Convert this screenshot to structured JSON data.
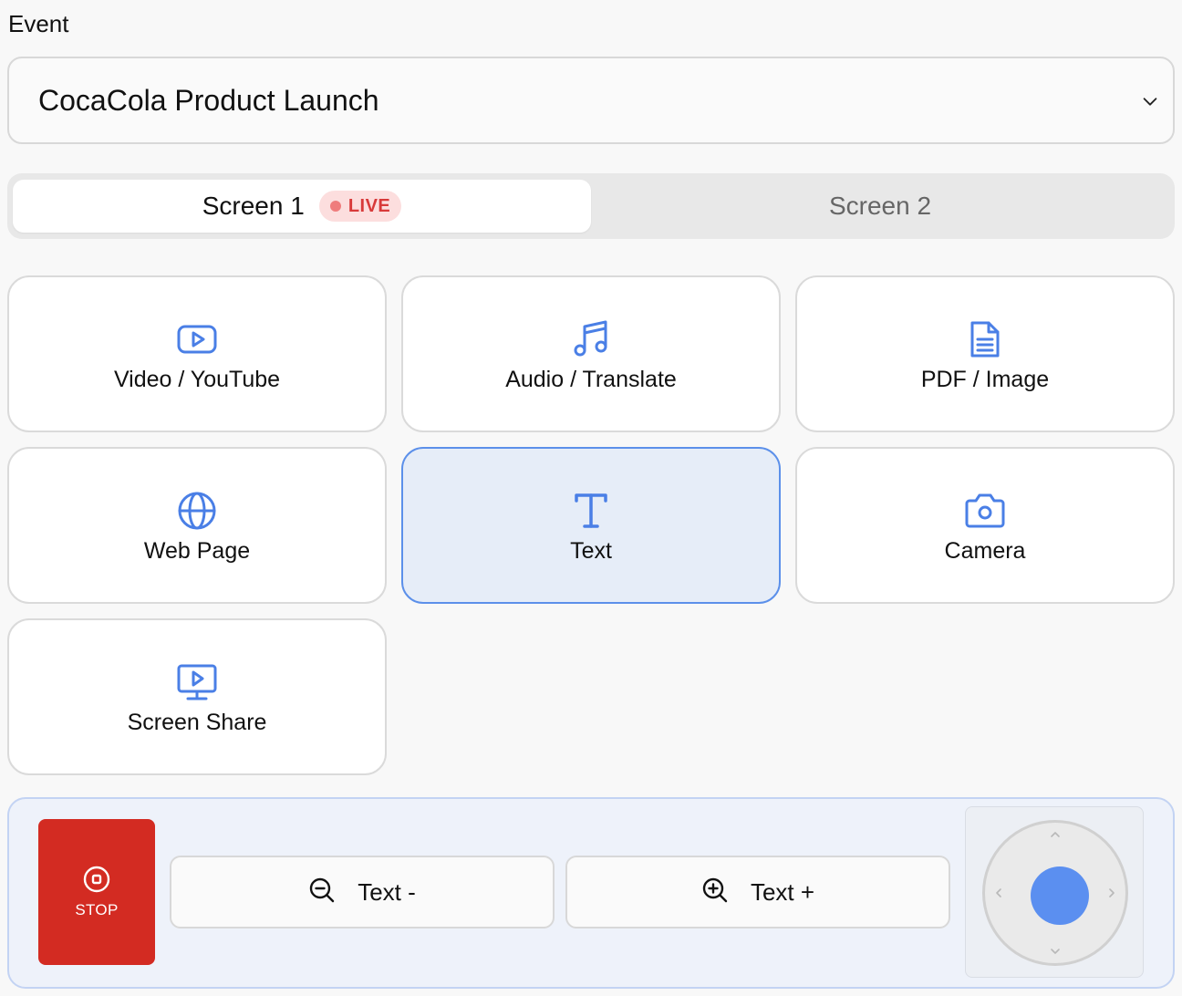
{
  "event": {
    "label": "Event",
    "selected": "CocaCola Product Launch"
  },
  "tabs": [
    {
      "label": "Screen 1",
      "badge": "LIVE",
      "active": true
    },
    {
      "label": "Screen 2",
      "active": false
    }
  ],
  "tiles": [
    {
      "label": "Video / YouTube",
      "icon": "youtube-icon"
    },
    {
      "label": "Audio / Translate",
      "icon": "music-note-icon"
    },
    {
      "label": "PDF / Image",
      "icon": "document-icon"
    },
    {
      "label": "Web Page",
      "icon": "globe-icon"
    },
    {
      "label": "Text",
      "icon": "text-t-icon",
      "selected": true
    },
    {
      "label": "Camera",
      "icon": "camera-icon"
    },
    {
      "label": "Screen Share",
      "icon": "screen-share-icon"
    }
  ],
  "controls": {
    "stop_label": "STOP",
    "text_minus_label": "Text -",
    "text_plus_label": "Text +"
  },
  "colors": {
    "accent": "#4a7fe6",
    "stop": "#d32b22",
    "live_text": "#d83a3a",
    "live_bg": "#fcdede",
    "selected_tile_bg": "#e6edf8",
    "joystick_knob": "#5b8ff0"
  }
}
